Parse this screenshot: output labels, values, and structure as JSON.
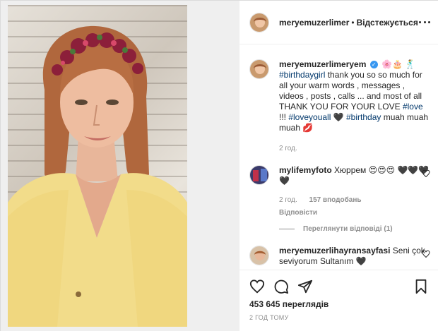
{
  "post_image": {
    "alt": ""
  },
  "header": {
    "username": "meryemuzerlimer",
    "separator": "•",
    "follow_status": "Відстежується",
    "more_icon": "more-horizontal-icon"
  },
  "caption": {
    "username": "meryemuzerlimeryem",
    "verified_icon": "verified-badge-icon",
    "text_start": "",
    "emoji": "🌸🎂 🕺",
    "hashtag1": "#birthdaygirl",
    "text1": " thank you so so much for all your warm words , messages , videos , posts , calls ... and most of all THANK YOU FOR YOUR LOVE ",
    "hashtag2": "#love",
    "text2": " !!! ",
    "hashtag3": "#loveyouall",
    "text3": " 🖤 ",
    "hashtag4": "#birthday",
    "text4": " muah muah muah 💋",
    "time": "2 год."
  },
  "comments": [
    {
      "username": "mylifemyfoto",
      "text": " Хюррем 😍😍😍 🖤🖤🖤🖤",
      "time": "2 год.",
      "likes": "157 вподобань",
      "reply": "Відповісти",
      "view_replies": "Переглянути відповіді (1)"
    },
    {
      "username": "meryemuzerlihayransayfasi",
      "text": " Seni çok seviyorum Sultanım 🖤"
    }
  ],
  "footer": {
    "like_icon": "heart-icon",
    "comment_icon": "comment-icon",
    "share_icon": "paper-plane-icon",
    "save_icon": "bookmark-icon",
    "views": "453 645 переглядів",
    "time": "2 ГОД ТОМУ"
  },
  "colors": {
    "link": "#00376b",
    "verified": "#3897f0",
    "meta": "#8e8e8e",
    "text": "#262626"
  }
}
